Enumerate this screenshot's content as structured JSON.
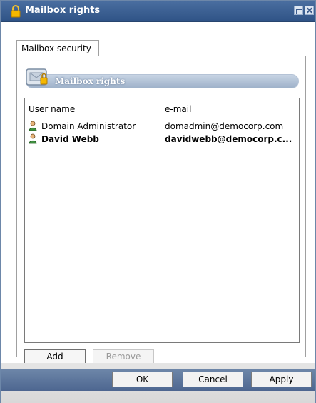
{
  "window": {
    "title": "Mailbox rights"
  },
  "tabs": [
    {
      "label": "Mailbox security"
    }
  ],
  "section": {
    "title": "Mailbox rights"
  },
  "list": {
    "columns": {
      "user": "User name",
      "email": "e-mail"
    },
    "rows": [
      {
        "name": "Domain Administrator",
        "email": "domadmin@democorp.com",
        "bold": false
      },
      {
        "name": "David Webb",
        "email": "davidwebb@democorp.c...",
        "bold": true
      }
    ]
  },
  "buttons": {
    "add": "Add",
    "remove": "Remove"
  },
  "footer": {
    "ok": "OK",
    "cancel": "Cancel",
    "apply": "Apply"
  },
  "icons": {
    "title": "lock-icon",
    "section": "mailbox-icon",
    "user": "user-icon"
  },
  "colors": {
    "titlebar": "#2f5386",
    "accent": "#6d86a8"
  }
}
